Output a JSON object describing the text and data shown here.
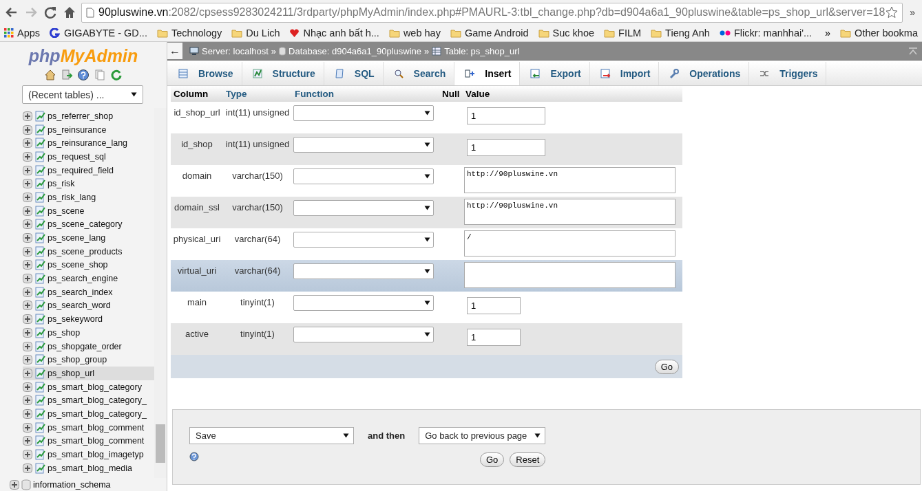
{
  "browser": {
    "url_host": "90pluswine.vn",
    "url_path": ":2082/cpsess9283024211/3rdparty/phpMyAdmin/index.php#PMAURL-3:tbl_change.php?db=d904a6a1_90pluswine&table=ps_shop_url&server=18",
    "overflow": "»"
  },
  "bookmarks": [
    {
      "kind": "apps",
      "label": "Apps"
    },
    {
      "kind": "gigabyte",
      "label": "GIGABYTE - GD..."
    },
    {
      "kind": "folder",
      "label": "Technology"
    },
    {
      "kind": "folder",
      "label": "Du Lich"
    },
    {
      "kind": "heart",
      "label": "Nhạc anh bất h..."
    },
    {
      "kind": "folder",
      "label": "web hay"
    },
    {
      "kind": "folder",
      "label": "Game Android"
    },
    {
      "kind": "folder",
      "label": "Suc khoe"
    },
    {
      "kind": "folder",
      "label": "FILM"
    },
    {
      "kind": "folder",
      "label": "Tieng Anh"
    },
    {
      "kind": "flickr",
      "label": "Flickr: manhhai'..."
    }
  ],
  "bookmarks_overflow": "»",
  "other_bookmarks": "Other bookma",
  "sidebar": {
    "logo_php": "php",
    "logo_rest": "MyAdmin",
    "recent": "(Recent tables) ...",
    "tables": [
      {
        "name": "ps_referrer_shop",
        "selected": false
      },
      {
        "name": "ps_reinsurance",
        "selected": false
      },
      {
        "name": "ps_reinsurance_lang",
        "selected": false
      },
      {
        "name": "ps_request_sql",
        "selected": false
      },
      {
        "name": "ps_required_field",
        "selected": false
      },
      {
        "name": "ps_risk",
        "selected": false
      },
      {
        "name": "ps_risk_lang",
        "selected": false
      },
      {
        "name": "ps_scene",
        "selected": false
      },
      {
        "name": "ps_scene_category",
        "selected": false
      },
      {
        "name": "ps_scene_lang",
        "selected": false
      },
      {
        "name": "ps_scene_products",
        "selected": false
      },
      {
        "name": "ps_scene_shop",
        "selected": false
      },
      {
        "name": "ps_search_engine",
        "selected": false
      },
      {
        "name": "ps_search_index",
        "selected": false
      },
      {
        "name": "ps_search_word",
        "selected": false
      },
      {
        "name": "ps_sekeyword",
        "selected": false
      },
      {
        "name": "ps_shop",
        "selected": false
      },
      {
        "name": "ps_shopgate_order",
        "selected": false
      },
      {
        "name": "ps_shop_group",
        "selected": false
      },
      {
        "name": "ps_shop_url",
        "selected": true
      },
      {
        "name": "ps_smart_blog_category",
        "selected": false
      },
      {
        "name": "ps_smart_blog_category_",
        "selected": false
      },
      {
        "name": "ps_smart_blog_category_",
        "selected": false
      },
      {
        "name": "ps_smart_blog_comment",
        "selected": false
      },
      {
        "name": "ps_smart_blog_comment",
        "selected": false
      },
      {
        "name": "ps_smart_blog_imagetyp",
        "selected": false
      },
      {
        "name": "ps_smart_blog_media",
        "selected": false
      }
    ],
    "database": "information_schema"
  },
  "breadcrumb": {
    "back": "←",
    "server": "Server: localhost",
    "database": "Database: d904a6a1_90pluswine",
    "table": "Table: ps_shop_url",
    "sep": "»"
  },
  "tabs": [
    {
      "label": "Browse",
      "selected": false
    },
    {
      "label": "Structure",
      "selected": false
    },
    {
      "label": "SQL",
      "selected": false
    },
    {
      "label": "Search",
      "selected": false
    },
    {
      "label": "Insert",
      "selected": true
    },
    {
      "label": "Export",
      "selected": false
    },
    {
      "label": "Import",
      "selected": false
    },
    {
      "label": "Operations",
      "selected": false
    },
    {
      "label": "Triggers",
      "selected": false
    }
  ],
  "table": {
    "columns": [
      "Column",
      "Type",
      "Function",
      "Null",
      "Value"
    ],
    "rows": [
      {
        "column": "id_shop_url",
        "type": "int(11) unsigned",
        "kind": "wide-input",
        "value": "1",
        "highlighted": false
      },
      {
        "column": "id_shop",
        "type": "int(11) unsigned",
        "kind": "wide-input",
        "value": "1",
        "highlighted": false
      },
      {
        "column": "domain",
        "type": "varchar(150)",
        "kind": "textarea",
        "value": "http://90pluswine.vn",
        "highlighted": false
      },
      {
        "column": "domain_ssl",
        "type": "varchar(150)",
        "kind": "textarea",
        "value": "http://90pluswine.vn",
        "highlighted": false
      },
      {
        "column": "physical_uri",
        "type": "varchar(64)",
        "kind": "textarea",
        "value": "/",
        "highlighted": false
      },
      {
        "column": "virtual_uri",
        "type": "varchar(64)",
        "kind": "textarea",
        "highlighted": true
      },
      {
        "column": "main",
        "type": "tinyint(1)",
        "kind": "short-input",
        "value": "1",
        "highlighted": false
      },
      {
        "column": "active",
        "type": "tinyint(1)",
        "kind": "short-input",
        "value": "1",
        "highlighted": false
      }
    ],
    "go": "Go"
  },
  "footer": {
    "action": "Save",
    "and_then": "and then",
    "after": "Go back to previous page",
    "go": "Go",
    "reset": "Reset"
  }
}
